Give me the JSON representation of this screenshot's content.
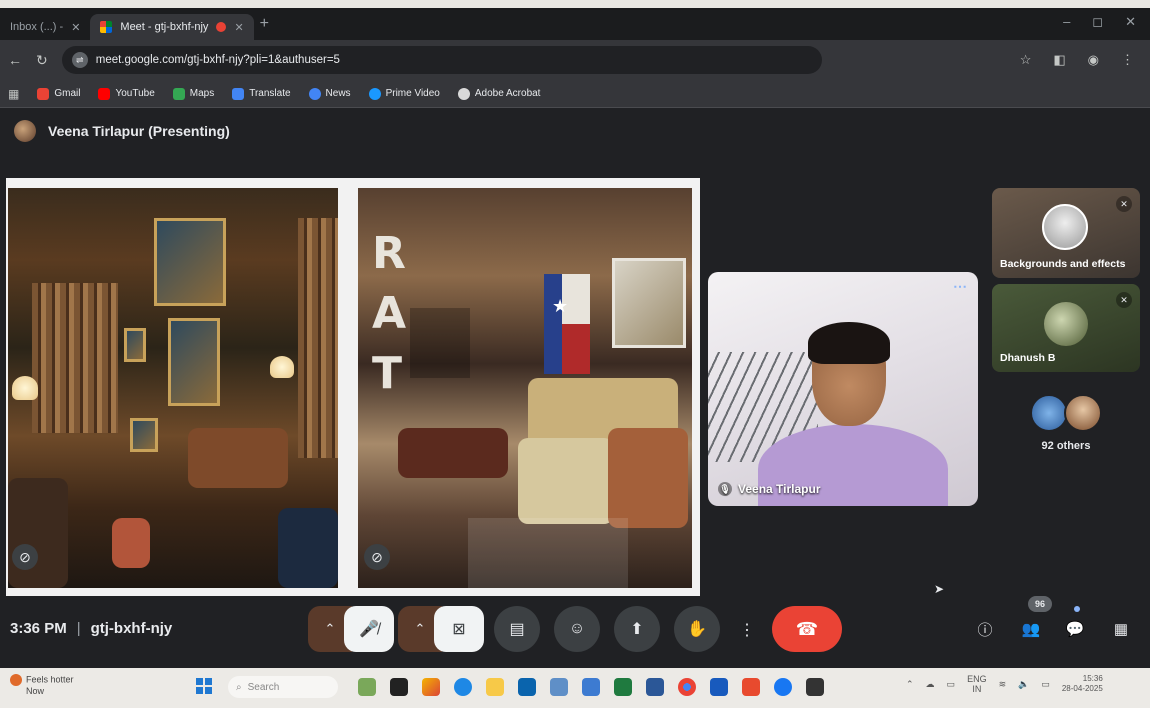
{
  "browser": {
    "tabs": [
      {
        "label": "Inbox (...) - ",
        "active": false
      },
      {
        "label": "Meet - gtj-bxhf-njy",
        "active": true
      }
    ],
    "new_tab": "+",
    "window_controls": [
      "–",
      "◻",
      "✕"
    ],
    "url": "meet.google.com/gtj-bxhf-njy?pli=1&authuser=5",
    "bookmarks": [
      {
        "label": "Gmail",
        "color": "#ea4335"
      },
      {
        "label": "YouTube",
        "color": "#ff0000"
      },
      {
        "label": "Maps",
        "color": "#34a853"
      },
      {
        "label": "Translate",
        "color": "#4285f4"
      },
      {
        "label": "News",
        "color": "#4285f4"
      },
      {
        "label": "Prime Video",
        "color": "#1a98ff"
      },
      {
        "label": "Adobe Acrobat",
        "color": "#d9d9d9"
      }
    ]
  },
  "meeting": {
    "presenter_label": "Veena Tirlapur (Presenting)",
    "speaker_name": "Veena Tirlapur",
    "side_tiles": [
      {
        "label": "Backgrounds and effects"
      },
      {
        "label": "Dhanush B"
      },
      {
        "label": "92 others"
      }
    ],
    "time": "3:36 PM",
    "separator": "|",
    "meeting_code": "gtj-bxhf-njy",
    "people_count": "96",
    "accent_end_call": "#ea4335"
  },
  "taskbar": {
    "weather_line1": "Feels hotter",
    "weather_line2": "Now",
    "search_placeholder": "Search",
    "lang_line1": "ENG",
    "lang_line2": "IN",
    "clock_time": "15:36",
    "clock_date": "28-04-2025"
  }
}
